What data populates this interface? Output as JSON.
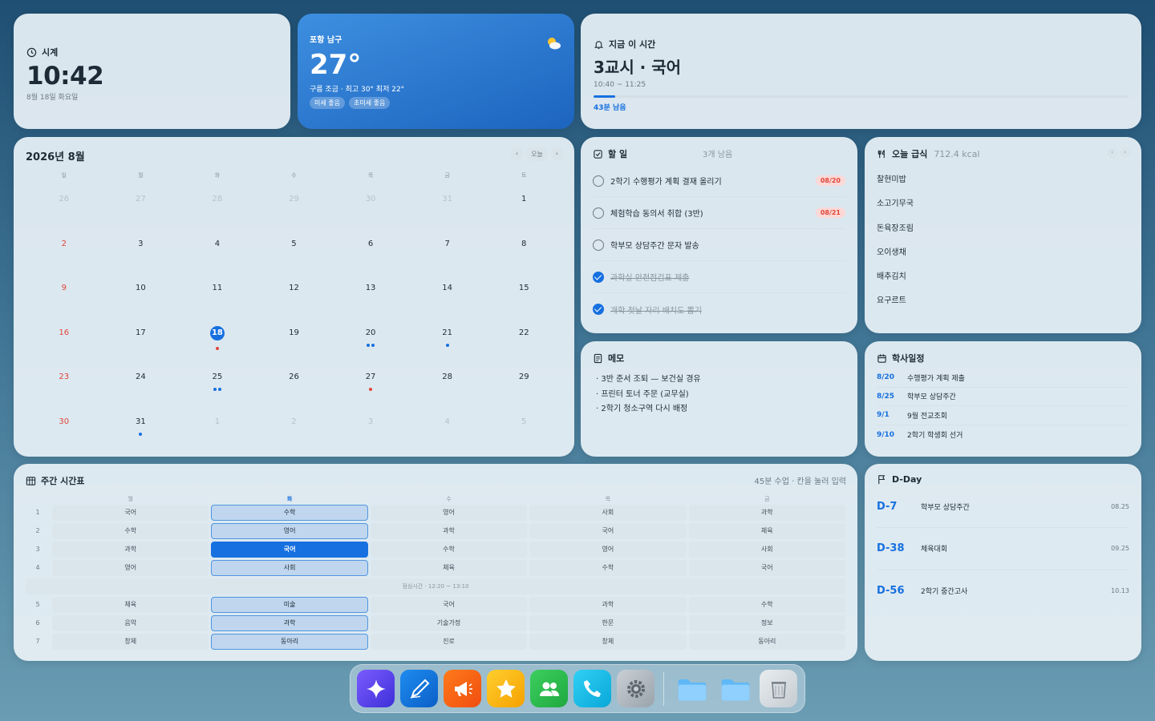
{
  "clock": {
    "title": "시계",
    "time": "10:42",
    "date": "8월 18일 화요일"
  },
  "weather": {
    "location": "포항 남구",
    "temp": "27°",
    "desc": "구름 조금 · 최고 30° 최저 22°",
    "chips": [
      "미세 좋음",
      "초미세 좋음"
    ],
    "icon": "partly-cloudy-icon"
  },
  "now": {
    "title": "지금 이 시간",
    "subject": "3교시 · 국어",
    "range": "10:40 ~ 11:25",
    "remaining": "43분 남음",
    "progress": 0.04
  },
  "calendar": {
    "title": "2026년 8월",
    "nav": [
      "‹",
      "오늘",
      "›"
    ],
    "weekdays": [
      "일",
      "월",
      "화",
      "수",
      "목",
      "금",
      "토"
    ],
    "days": [
      {
        "n": "26",
        "out": true
      },
      {
        "n": "27",
        "out": true
      },
      {
        "n": "28",
        "out": true
      },
      {
        "n": "29",
        "out": true
      },
      {
        "n": "30",
        "out": true
      },
      {
        "n": "31",
        "out": true
      },
      {
        "n": "1"
      },
      {
        "n": "2",
        "sun": true
      },
      {
        "n": "3"
      },
      {
        "n": "4"
      },
      {
        "n": "5"
      },
      {
        "n": "6"
      },
      {
        "n": "7"
      },
      {
        "n": "8"
      },
      {
        "n": "9",
        "sun": true
      },
      {
        "n": "10"
      },
      {
        "n": "11"
      },
      {
        "n": "12"
      },
      {
        "n": "13"
      },
      {
        "n": "14"
      },
      {
        "n": "15"
      },
      {
        "n": "16",
        "sun": true
      },
      {
        "n": "17"
      },
      {
        "n": "18",
        "today": true,
        "dots": [
          "#e0453a"
        ]
      },
      {
        "n": "19"
      },
      {
        "n": "20",
        "dots": [
          "#1670e0",
          "#1670e0"
        ]
      },
      {
        "n": "21",
        "dots": [
          "#1670e0"
        ]
      },
      {
        "n": "22"
      },
      {
        "n": "23",
        "sun": true
      },
      {
        "n": "24"
      },
      {
        "n": "25",
        "dots": [
          "#1670e0",
          "#1670e0"
        ]
      },
      {
        "n": "26"
      },
      {
        "n": "27",
        "dots": [
          "#e0453a"
        ]
      },
      {
        "n": "28"
      },
      {
        "n": "29"
      },
      {
        "n": "30",
        "sun": true
      },
      {
        "n": "31",
        "dots": [
          "#1670e0"
        ]
      },
      {
        "n": "1",
        "out": true
      },
      {
        "n": "2",
        "out": true
      },
      {
        "n": "3",
        "out": true
      },
      {
        "n": "4",
        "out": true
      },
      {
        "n": "5",
        "out": true
      }
    ]
  },
  "todo": {
    "title": "할 일",
    "remaining": "3개 남음",
    "items": [
      {
        "text": "2학기 수행평가 계획 결재 올리기",
        "due": "08/20",
        "done": false
      },
      {
        "text": "체험학습 동의서 취합 (3반)",
        "due": "08/21",
        "done": false
      },
      {
        "text": "학부모 상담주간 문자 발송",
        "due": "",
        "done": false
      },
      {
        "text": "과학실 안전점검표 제출",
        "due": "",
        "done": true
      },
      {
        "text": "개학 첫날 자리 배치도 뽑기",
        "due": "",
        "done": true
      }
    ]
  },
  "lunch": {
    "title": "오늘 급식",
    "kcal": "712.4 kcal",
    "items": [
      "찰현미밥",
      "소고기무국",
      "돈육장조림",
      "오이생채",
      "배추김치",
      "요구르트"
    ]
  },
  "memo": {
    "title": "메모",
    "lines": [
      "· 3반 준서 조퇴 — 보건실 경유",
      "· 프린터 토너 주문 (교무실)",
      "· 2학기 청소구역 다시 배정"
    ]
  },
  "schedule": {
    "title": "학사일정",
    "items": [
      {
        "date": "8/20",
        "text": "수행평가 계획 제출"
      },
      {
        "date": "8/25",
        "text": "학부모 상담주간"
      },
      {
        "date": "9/1",
        "text": "9월 전교조회"
      },
      {
        "date": "9/10",
        "text": "2학기 학생회 선거"
      }
    ]
  },
  "timetable": {
    "title": "주간 시간표",
    "hint": "45분 수업 · 칸을 눌러 입력",
    "days": [
      "월",
      "화",
      "수",
      "목",
      "금"
    ],
    "morning": [
      {
        "p": "1",
        "c": [
          "국어",
          "수학",
          "영어",
          "사회",
          "과학"
        ]
      },
      {
        "p": "2",
        "c": [
          "수학",
          "영어",
          "과학",
          "국어",
          "체육"
        ]
      },
      {
        "p": "3",
        "c": [
          "과학",
          "국어",
          "수학",
          "영어",
          "사회"
        ]
      },
      {
        "p": "4",
        "c": [
          "영어",
          "사회",
          "체육",
          "수학",
          "국어"
        ]
      }
    ],
    "lunch": "점심시간 · 12:20 ~ 13:10",
    "afternoon": [
      {
        "p": "5",
        "c": [
          "체육",
          "미술",
          "국어",
          "과학",
          "수학"
        ]
      },
      {
        "p": "6",
        "c": [
          "음악",
          "과학",
          "기술가정",
          "한문",
          "정보"
        ]
      },
      {
        "p": "7",
        "c": [
          "창체",
          "동아리",
          "진로",
          "창체",
          "동아리"
        ]
      }
    ]
  },
  "dday": {
    "title": "D-Day",
    "items": [
      {
        "d": "D-7",
        "name": "학부모 상담주간",
        "date": "08.25"
      },
      {
        "d": "D-38",
        "name": "체육대회",
        "date": "09.25"
      },
      {
        "d": "D-56",
        "name": "2학기 중간고사",
        "date": "10.13"
      }
    ]
  },
  "dock": {
    "apps": [
      "ai-sparkle-icon",
      "pen-icon",
      "megaphone-icon",
      "star-icon",
      "people-icon",
      "phone-icon",
      "settings-icon"
    ],
    "folders": [
      "folder-icon",
      "folder-icon",
      "trash-icon"
    ]
  }
}
